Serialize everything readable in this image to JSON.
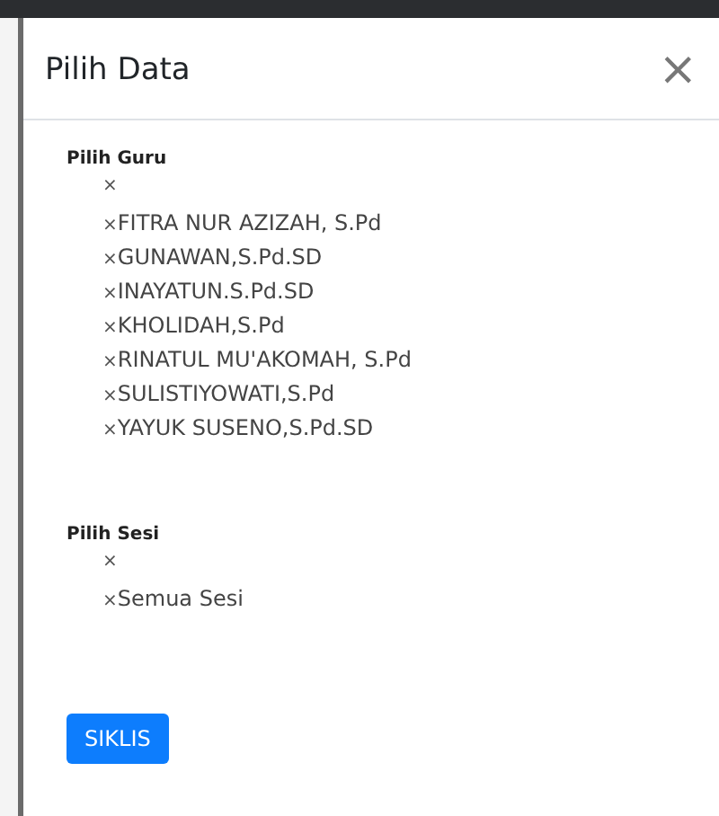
{
  "modal": {
    "title": "Pilih Data",
    "close": "×"
  },
  "sections": [
    {
      "label": "Pilih Guru",
      "items": [
        {
          "remove": "×"
        },
        {
          "remove": "×",
          "label": "FITRA NUR AZIZAH, S.Pd"
        },
        {
          "remove": "×",
          "label": "GUNAWAN,S.Pd.SD"
        },
        {
          "remove": "×",
          "label": "INAYATUN.S.Pd.SD"
        },
        {
          "remove": "×",
          "label": "KHOLIDAH,S.Pd"
        },
        {
          "remove": "×",
          "label": "RINATUL MU'AKOMAH, S.Pd"
        },
        {
          "remove": "×",
          "label": "SULISTIYOWATI,S.Pd"
        },
        {
          "remove": "×",
          "label": "YAYUK SUSENO,S.Pd.SD"
        }
      ]
    },
    {
      "label": "Pilih Sesi",
      "items": [
        {
          "remove": "×"
        },
        {
          "remove": "×",
          "label": "Semua Sesi"
        }
      ]
    }
  ],
  "button": "SIKLIS"
}
